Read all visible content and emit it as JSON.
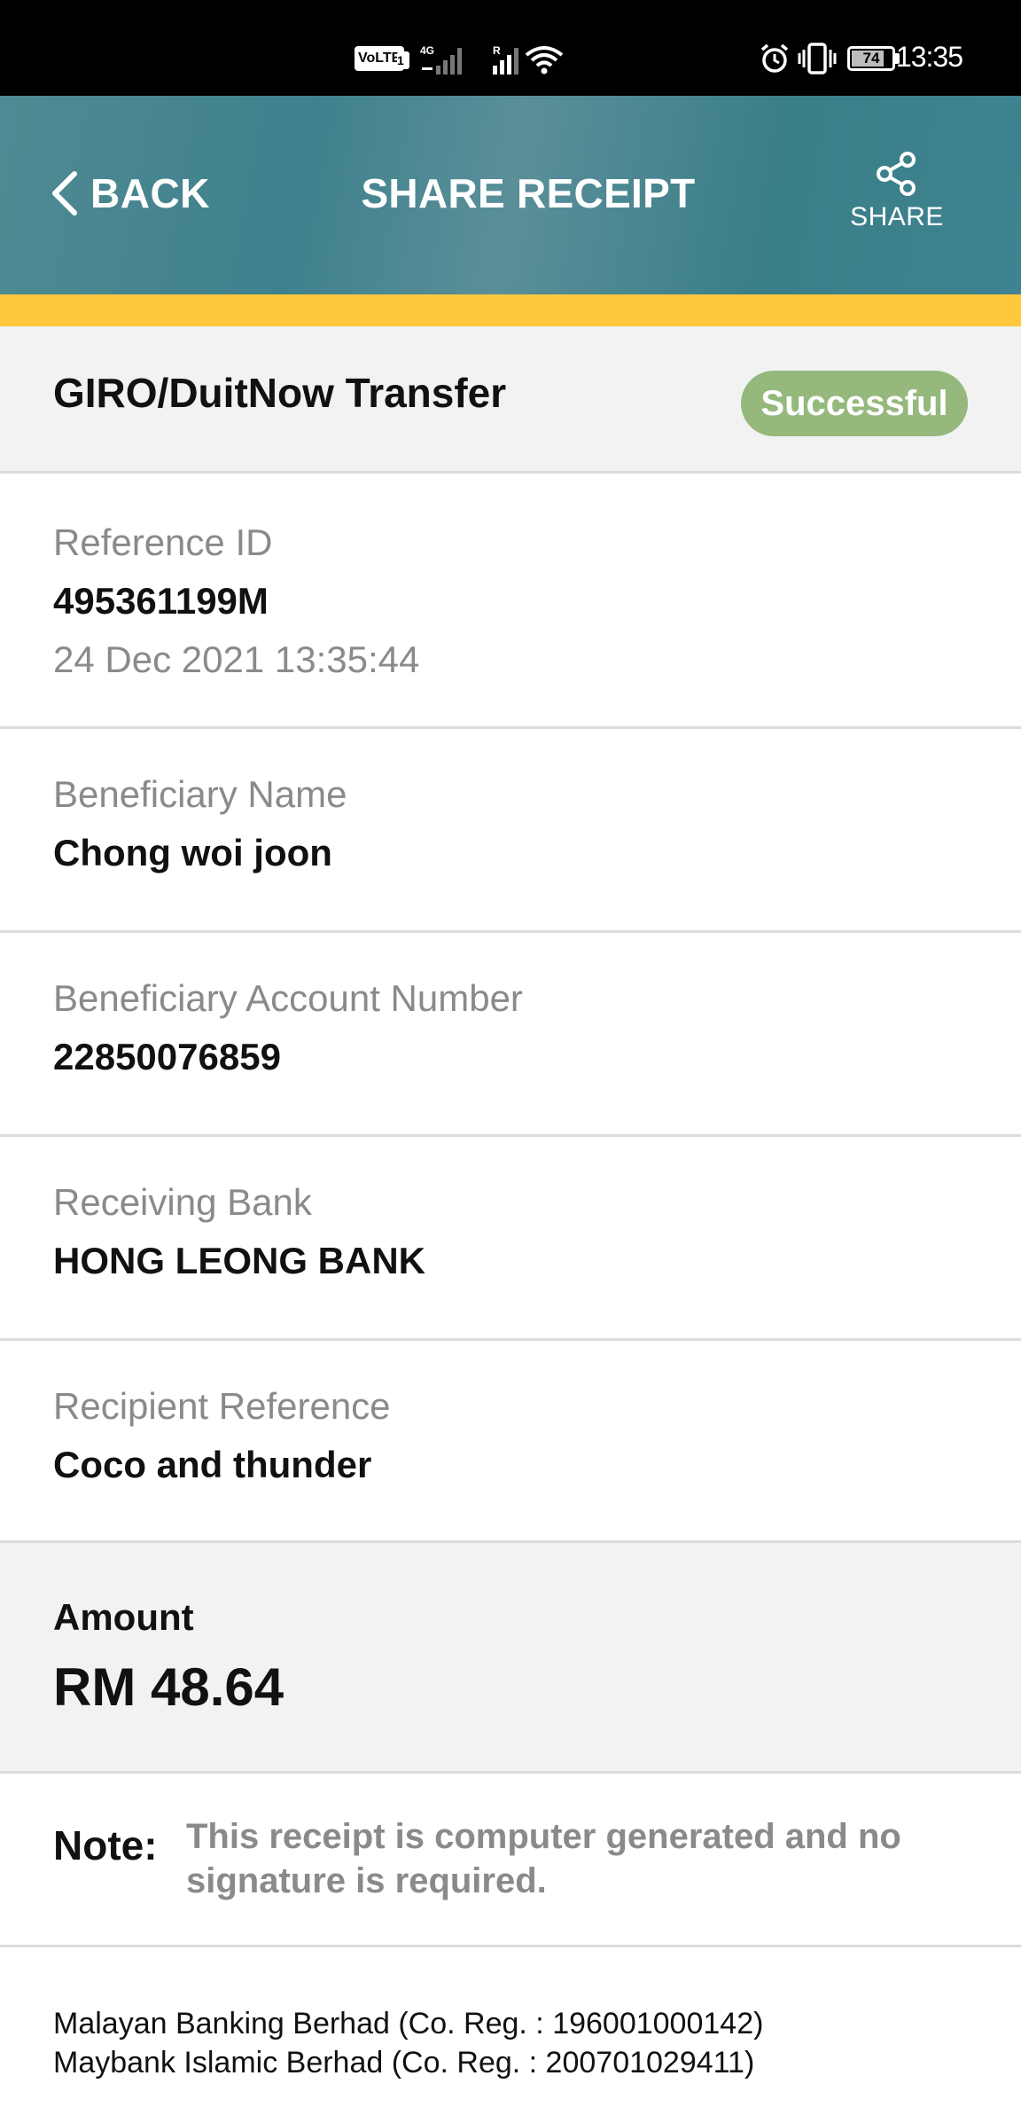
{
  "status_bar": {
    "time": "13:35",
    "battery_level": "74",
    "volte_label": "VoLTE",
    "sim_slot": "1",
    "net_type": "4G",
    "roaming": "R",
    "icons": [
      "volte-icon",
      "cell-signal-icon",
      "wifi-icon",
      "alarm-icon",
      "vibrate-icon",
      "battery-icon"
    ]
  },
  "header": {
    "back_label": "BACK",
    "title": "SHARE RECEIPT",
    "share_label": "SHARE"
  },
  "receipt": {
    "transaction_type": "GIRO/DuitNow Transfer",
    "status": "Successful",
    "reference_label": "Reference ID",
    "reference_id": "495361199M",
    "datetime": "24 Dec 2021 13:35:44",
    "beneficiary_name_label": "Beneficiary Name",
    "beneficiary_name": "Chong woi joon",
    "beneficiary_account_label": "Beneficiary Account Number",
    "beneficiary_account": "22850076859",
    "receiving_bank_label": "Receiving Bank",
    "receiving_bank": "HONG LEONG BANK",
    "recipient_reference_label": "Recipient Reference",
    "recipient_reference": "Coco and thunder",
    "amount_label": "Amount",
    "amount": "RM 48.64"
  },
  "note": {
    "label": "Note:",
    "text": "This receipt is computer generated and no signature is required."
  },
  "footer": {
    "line1": "Malayan Banking Berhad (Co. Reg. : 196001000142)",
    "line2": "Maybank Islamic Berhad (Co. Reg. : 200701029411)"
  },
  "colors": {
    "header_bg": "#3f818d",
    "accent": "#ffc83d",
    "success": "#95b87c"
  }
}
